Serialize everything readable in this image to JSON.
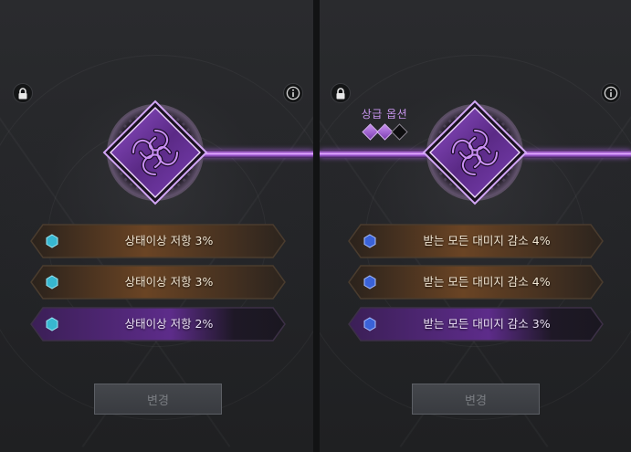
{
  "left_panel": {
    "options": [
      {
        "label": "상태이상 저항 3%",
        "tier": "orange"
      },
      {
        "label": "상태이상 저항 3%",
        "tier": "orange"
      },
      {
        "label": "상태이상 저항 2%",
        "tier": "purple"
      }
    ],
    "change_button": "변경"
  },
  "right_panel": {
    "grade_label": "상급 옵션",
    "grade_gems": {
      "filled": 2,
      "total": 3
    },
    "options": [
      {
        "label": "받는 모든 대미지 감소 4%",
        "tier": "orange"
      },
      {
        "label": "받는 모든 대미지 감소 4%",
        "tier": "orange"
      },
      {
        "label": "받는 모든 대미지 감소 3%",
        "tier": "purple"
      }
    ],
    "change_button": "변경"
  },
  "icons": {
    "lock": "lock-icon",
    "info": "info-icon",
    "emblem": "celtic-knot-emblem-icon",
    "option_left": "cyan-hexagon-icon",
    "option_right": "blue-hexagon-icon"
  },
  "colors": {
    "orange_row": "#4a3522",
    "orange_glow": "#b8813c",
    "purple_row": "#3a2150",
    "purple_glow": "#8b4fc4",
    "connector": "#c67ef2",
    "grade_text": "#c694ec",
    "hex_cyan": "#37b7d0",
    "hex_blue": "#3a62d8"
  }
}
